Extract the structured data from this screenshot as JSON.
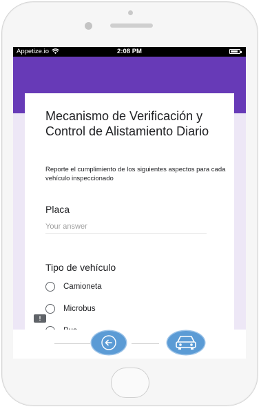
{
  "status_bar": {
    "carrier": "Appetize.io",
    "time": "2:08 PM",
    "battery_level": 0.8
  },
  "form": {
    "title": "Mecanismo de Verificación y Control de Alistamiento Diario",
    "description": "Reporte el cumplimiento de los siguientes aspectos para cada vehículo inspeccionado",
    "placa": {
      "label": "Placa",
      "placeholder": "Your answer"
    },
    "tipo_vehiculo": {
      "label": "Tipo de vehículo",
      "options": [
        "Camioneta",
        "Microbus",
        "Bus"
      ]
    }
  },
  "feedback": {
    "label": "!"
  },
  "icons": {
    "back": "arrow-left-icon",
    "vehicle": "car-icon",
    "wifi": "wifi-icon",
    "battery": "battery-icon"
  },
  "colors": {
    "primary": "#673ab7",
    "background": "#ede7f6",
    "fab": "#5b9bd5"
  }
}
